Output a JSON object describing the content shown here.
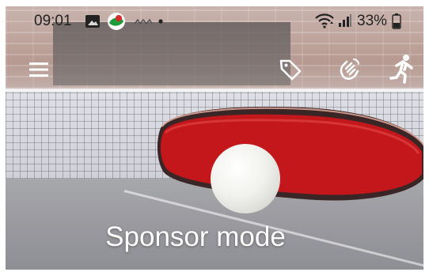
{
  "status_bar": {
    "time": "09:01",
    "battery_text": "33%",
    "icons": [
      "image-icon",
      "app-notification-icon",
      "carrier-icon",
      "dot-icon",
      "wifi-icon",
      "signal-icon",
      "battery-icon"
    ]
  },
  "app_bar": {
    "icons": [
      "menu-icon",
      "tag-icon",
      "wave-hand-icon",
      "running-person-icon"
    ]
  },
  "main": {
    "title": "Sponsor mode"
  }
}
